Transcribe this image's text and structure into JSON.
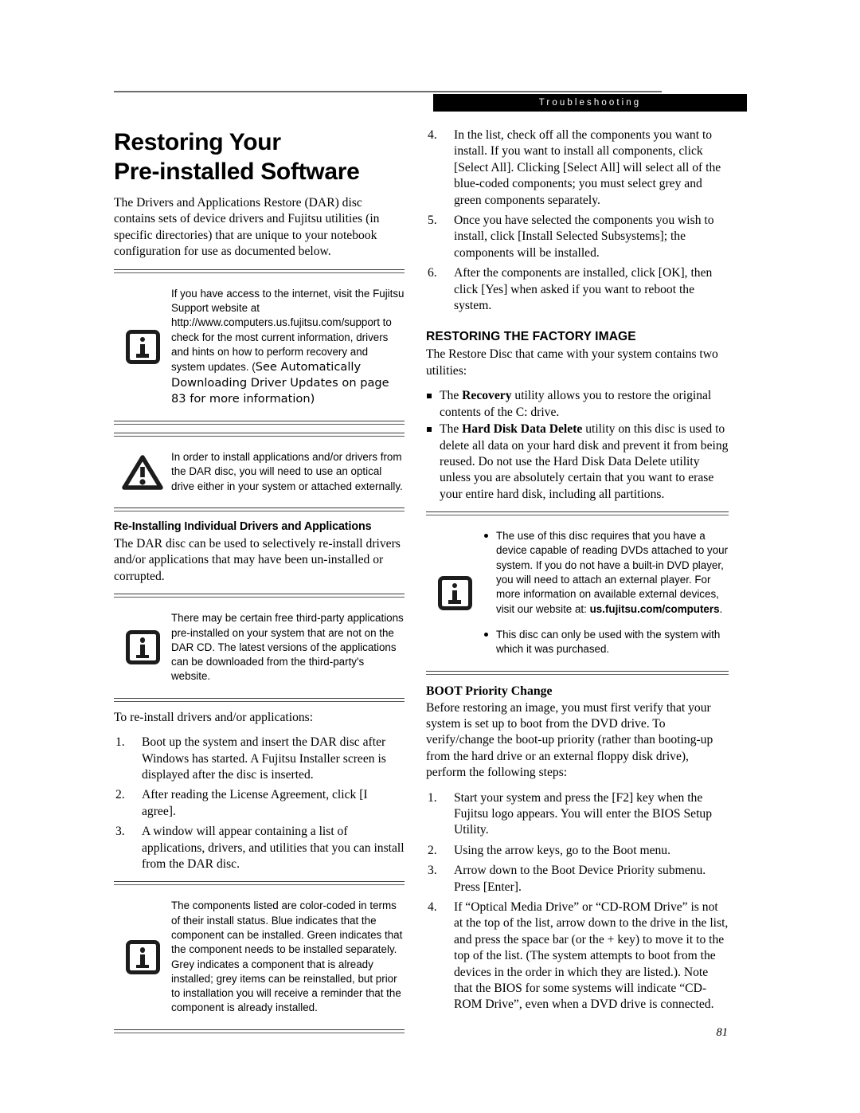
{
  "header": {
    "running_head": "Troubleshooting"
  },
  "page_number": "81",
  "left_column": {
    "title_line1": "Restoring Your",
    "title_line2": "Pre-installed Software",
    "intro": "The Drivers and Applications Restore (DAR) disc contains sets of device drivers and Fujitsu utilities (in specific directories) that are unique to your notebook configuration for use as documented below.",
    "note_internet": {
      "icon": "info-icon",
      "text": "If you have access to the internet, visit the Fujitsu Support website at http://www.computers.us.fujitsu.com/support to check for the most current information, drivers and hints on how to perform recovery and system updates. (",
      "xref": "See Automatically Downloading Driver Updates on page 83 for more information)"
    },
    "note_optical": {
      "icon": "warning-icon",
      "text": "In order to install applications and/or drivers from the DAR disc, you will need to use an optical drive either in your system or attached externally."
    },
    "subhead_reinstall": "Re-Installing Individual Drivers and Applications",
    "reinstall_body": "The DAR disc can be used to selectively re-install drivers and/or applications that may have been un-installed or corrupted.",
    "note_thirdparty": {
      "icon": "info-icon",
      "text": "There may be certain free third-party applications pre-installed on your system that are not on the DAR CD. The latest versions of the applications can be downloaded from the third-party's website."
    },
    "lead_in": "To re-install drivers and/or applications:",
    "steps": [
      {
        "num": "1.",
        "text": "Boot up the system and insert the DAR disc after Windows has started. A Fujitsu Installer screen is displayed after the disc is inserted."
      },
      {
        "num": "2.",
        "text": "After reading the License Agreement, click [I agree]."
      },
      {
        "num": "3.",
        "text": "A window will appear containing a list of applications, drivers, and utilities that you can install from the DAR disc."
      }
    ],
    "note_colorcode": {
      "icon": "info-icon",
      "text": "The components listed are color-coded in terms of their install status. Blue indicates that the component can be installed. Green indicates that the component needs to be installed separately. Grey indicates a component that is already installed; grey items can be reinstalled, but prior to installation you will receive a reminder that the component is already installed."
    }
  },
  "right_column": {
    "steps_continued": [
      {
        "num": "4.",
        "text": "In the list, check off all the components you want to install. If you want to install all components, click [Select All]. Clicking [Select All] will select all of the blue-coded components; you must select grey and green components separately."
      },
      {
        "num": "5.",
        "text": "Once you have selected the components you wish to install, click [Install Selected Subsystems]; the components will be installed."
      },
      {
        "num": "6.",
        "text": "After the components are installed, click [OK], then click [Yes] when asked if you want to reboot the system."
      }
    ],
    "section_head": "RESTORING THE FACTORY IMAGE",
    "restore_intro": "The Restore Disc that came with your system contains two utilities:",
    "utilities": [
      {
        "prefix": "The ",
        "bold": "Recovery",
        "suffix": " utility allows you to restore the original contents of the C: drive."
      },
      {
        "prefix": "The ",
        "bold": "Hard Disk Data Delete",
        "suffix": " utility on this disc is used to delete all data on your hard disk and prevent it from being reused. Do not use the Hard Disk Data Delete utility unless you are absolutely certain that you want to erase your entire hard disk, including all partitions."
      }
    ],
    "note_dvd": {
      "icon": "info-icon",
      "bullet1_text": "The use of this disc requires that you have a device capable of reading DVDs attached to your system. If you do not have a built-in DVD player, you will need to attach an external player. For more information on available external devices, visit our website at: ",
      "bullet1_bold": "us.fujitsu.com/computers",
      "bullet1_tail": ".",
      "bullet2_text": "This disc can only be used with the system with which it was purchased."
    },
    "boot_head": "BOOT Priority Change",
    "boot_intro": "Before restoring an image, you must first verify that your system is set up to boot from the DVD drive. To verify/change the boot-up priority (rather than booting-up from the hard drive or an external floppy disk drive), perform the following steps:",
    "boot_steps": [
      {
        "num": "1.",
        "text": "Start your system and press the [F2] key when the Fujitsu logo appears. You will enter the BIOS Setup Utility."
      },
      {
        "num": "2.",
        "text": "Using the arrow keys, go to the Boot menu."
      },
      {
        "num": "3.",
        "text": "Arrow down to the Boot Device Priority submenu. Press [Enter]."
      },
      {
        "num": "4.",
        "text": "If “Optical Media Drive” or “CD-ROM Drive” is not at the top of the list, arrow down to the drive in the list, and press the space bar (or the + key) to move it to the top of the list. (The system attempts to boot from the devices in the order in which they are listed.). Note that the BIOS for some systems will indicate “CD-ROM Drive”, even when a DVD drive is connected."
      }
    ]
  }
}
